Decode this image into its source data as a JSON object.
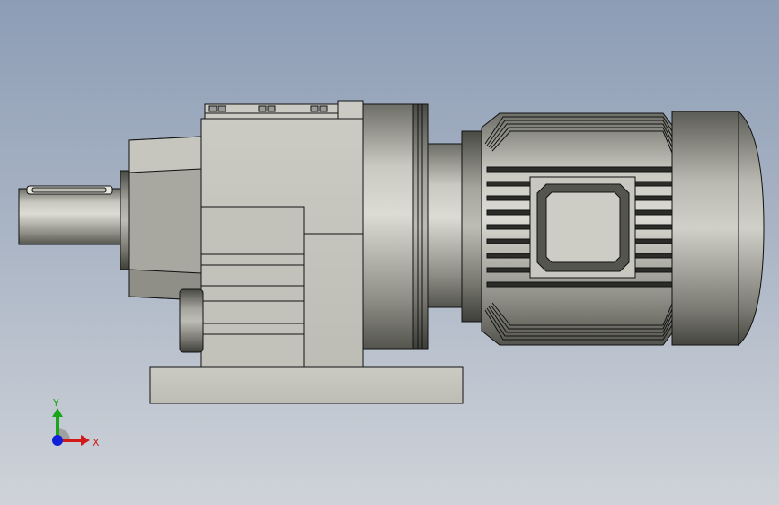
{
  "viewport": {
    "background_top": "#8d9db6",
    "background_bottom": "#cfd3d9"
  },
  "model": {
    "part": "helical-geared-motor",
    "view": "front",
    "body_color": "#c8c8c0",
    "edge_color": "#000000"
  },
  "triad": {
    "y_label": "Y",
    "x_label": "X",
    "y_color": "#1aa51a",
    "x_color": "#d21818",
    "z_color": "#1020d8"
  }
}
